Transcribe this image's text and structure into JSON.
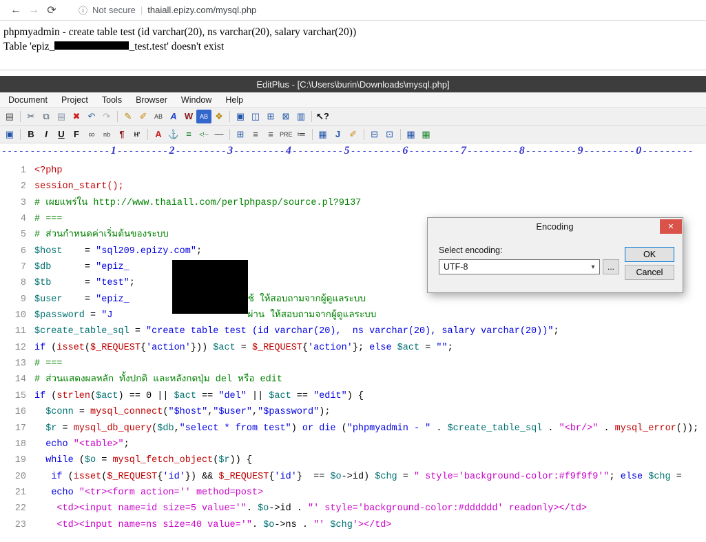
{
  "browser": {
    "back_icon": "←",
    "forward_icon": "→",
    "refresh_icon": "⟳",
    "info_icon": "ⓘ",
    "security_label": "Not secure",
    "url_separator": "|",
    "url": "thaiall.epizy.com/mysql.php",
    "page_line1": "phpmyadmin - create table test (id varchar(20), ns varchar(20), salary varchar(20))",
    "page_line2_before": "Table 'epiz_",
    "page_line2_after": "_test.test' doesn't exist"
  },
  "editor": {
    "title": "EditPlus - [C:\\Users\\burin\\Downloads\\mysql.php]",
    "menus": [
      "Document",
      "Project",
      "Tools",
      "Browser",
      "Window",
      "Help"
    ],
    "ruler_numbers": [
      "1",
      "2",
      "3",
      "4",
      "5",
      "6",
      "7",
      "8",
      "9",
      "0"
    ],
    "toolbar_row1": [
      {
        "glyph": "▤",
        "name": "document-icon",
        "color": "#555555"
      },
      {
        "sep": true
      },
      {
        "glyph": "✂",
        "name": "cut-icon",
        "color": "#445566"
      },
      {
        "glyph": "⧉",
        "name": "copy-icon",
        "color": "#445566"
      },
      {
        "glyph": "▤",
        "name": "paste-icon",
        "color": "#8899aa"
      },
      {
        "glyph": "✖",
        "name": "delete-icon",
        "color": "#cc2222"
      },
      {
        "glyph": "↶",
        "name": "undo-icon",
        "color": "#336699"
      },
      {
        "glyph": "↷",
        "name": "redo-icon",
        "color": "#b0b0b0"
      },
      {
        "sep": true
      },
      {
        "glyph": "✎",
        "name": "edit-pencil-icon",
        "color": "#b8860b"
      },
      {
        "glyph": "✐",
        "name": "marker-icon",
        "color": "#cc8800"
      },
      {
        "glyph": "AB",
        "name": "select-text-icon",
        "color": "#333333",
        "small": true
      },
      {
        "glyph": "A",
        "name": "font-italic-icon",
        "color": "#2244cc",
        "italic": true,
        "bold": true
      },
      {
        "glyph": "W",
        "name": "spellcheck-icon",
        "color": "#8b1a1a",
        "bold": true
      },
      {
        "glyph": "AB",
        "name": "highlight-icon",
        "color": "#ffffff",
        "bg": "#3366cc",
        "small": true
      },
      {
        "glyph": "❖",
        "name": "stamp-icon",
        "color": "#b8860b"
      },
      {
        "sep": true
      },
      {
        "glyph": "▣",
        "name": "window-full-icon",
        "color": "#2255aa"
      },
      {
        "glyph": "◫",
        "name": "window-split-icon",
        "color": "#2255aa"
      },
      {
        "glyph": "⊞",
        "name": "window-table-icon",
        "color": "#2255aa"
      },
      {
        "glyph": "⊠",
        "name": "window-close-icon",
        "color": "#2255aa"
      },
      {
        "glyph": "▥",
        "name": "window-list-icon",
        "color": "#2255aa"
      },
      {
        "sep": true
      },
      {
        "glyph": "↖?",
        "name": "context-help-icon",
        "color": "#111111",
        "bold": true
      }
    ],
    "toolbar_row2": [
      {
        "glyph": "▣",
        "name": "view-browser-icon",
        "color": "#2255aa"
      },
      {
        "sep": true
      },
      {
        "glyph": "B",
        "name": "bold-icon",
        "color": "#111111",
        "bold": true
      },
      {
        "glyph": "I",
        "name": "italic-icon",
        "color": "#111111",
        "italic": true,
        "bold": true
      },
      {
        "glyph": "U",
        "name": "underline-icon",
        "color": "#111111",
        "underline": true,
        "bold": true
      },
      {
        "glyph": "F",
        "name": "font-icon",
        "color": "#111111",
        "bold": true
      },
      {
        "glyph": "∞",
        "name": "glasses-icon",
        "color": "#555555"
      },
      {
        "glyph": "nb",
        "name": "nbsp-icon",
        "color": "#333333",
        "small": true
      },
      {
        "glyph": "¶",
        "name": "paragraph-icon",
        "color": "#8b1a1a",
        "bold": true
      },
      {
        "glyph": "H'",
        "name": "heading-icon",
        "color": "#111111",
        "bold": true,
        "small": true
      },
      {
        "sep": true
      },
      {
        "glyph": "A",
        "name": "font-color-icon",
        "color": "#cc2222",
        "bold": true
      },
      {
        "glyph": "⚓",
        "name": "anchor-icon",
        "color": "#2255aa"
      },
      {
        "glyph": "=",
        "name": "equals-icon",
        "color": "#228833",
        "bold": true
      },
      {
        "glyph": "<!--",
        "name": "comment-icon",
        "color": "#228833",
        "small": true
      },
      {
        "glyph": "—",
        "name": "hr-icon",
        "color": "#333333"
      },
      {
        "sep": true
      },
      {
        "glyph": "⊞",
        "name": "table-icon",
        "color": "#2255aa"
      },
      {
        "glyph": "≡",
        "name": "align-left-icon",
        "color": "#333333"
      },
      {
        "glyph": "≡",
        "name": "align-center-icon",
        "color": "#333333"
      },
      {
        "glyph": "PRE",
        "name": "pre-icon",
        "color": "#333333",
        "small": true
      },
      {
        "glyph": "≔",
        "name": "list-icon",
        "color": "#333333"
      },
      {
        "sep": true
      },
      {
        "glyph": "▦",
        "name": "image-icon",
        "color": "#2255aa"
      },
      {
        "glyph": "J",
        "name": "javascript-icon",
        "color": "#2255aa",
        "bold": true
      },
      {
        "glyph": "✐",
        "name": "style-brush-icon",
        "color": "#cc8822"
      },
      {
        "sep": true
      },
      {
        "glyph": "⊟",
        "name": "sync-browser-icon",
        "color": "#2255aa"
      },
      {
        "glyph": "⊡",
        "name": "sync-file-icon",
        "color": "#2255aa"
      },
      {
        "sep": true
      },
      {
        "glyph": "▦",
        "name": "table-insert-icon",
        "color": "#2255aa"
      },
      {
        "glyph": "▦",
        "name": "table-green-icon",
        "color": "#228833"
      }
    ],
    "code_lines": [
      {
        "n": 1,
        "segs": [
          {
            "t": "<?php",
            "c": "php"
          }
        ]
      },
      {
        "n": 2,
        "segs": [
          {
            "t": "session_start();",
            "c": "fn"
          }
        ]
      },
      {
        "n": 3,
        "segs": [
          {
            "t": "# เผยแพร่ใน http://www.thaiall.com/perlphpasp/source.pl?9137",
            "c": "com"
          }
        ]
      },
      {
        "n": 4,
        "segs": [
          {
            "t": "# ===",
            "c": "com"
          }
        ]
      },
      {
        "n": 5,
        "segs": [
          {
            "t": "# ส่วนกำหนดค่าเริ่มต้นของระบบ",
            "c": "com"
          }
        ]
      },
      {
        "n": 6,
        "segs": [
          {
            "t": "$host",
            "c": "var"
          },
          {
            "t": "    = ",
            "c": "pl"
          },
          {
            "t": "\"sql209.epizy.com\"",
            "c": "str"
          },
          {
            "t": ";",
            "c": "pl"
          }
        ]
      },
      {
        "n": 7,
        "segs": [
          {
            "t": "$db",
            "c": "var"
          },
          {
            "t": "      = ",
            "c": "pl"
          },
          {
            "t": "\"epiz_",
            "c": "str"
          }
        ]
      },
      {
        "n": 8,
        "segs": [
          {
            "t": "$tb",
            "c": "var"
          },
          {
            "t": "      = ",
            "c": "pl"
          },
          {
            "t": "\"test\"",
            "c": "str"
          },
          {
            "t": ";",
            "c": "pl"
          }
        ]
      },
      {
        "n": 9,
        "segs": [
          {
            "t": "$user",
            "c": "var"
          },
          {
            "t": "    = ",
            "c": "pl"
          },
          {
            "t": "\"epiz_",
            "c": "str"
          },
          {
            "c": "gap",
            "w": 172
          },
          {
            "t": "ช้ ให้สอบถามจากผู้ดูแลระบบ",
            "c": "com"
          }
        ]
      },
      {
        "n": 10,
        "segs": [
          {
            "t": "$password",
            "c": "var"
          },
          {
            "t": " = ",
            "c": "pl"
          },
          {
            "t": "\"J",
            "c": "str"
          },
          {
            "c": "gap",
            "w": 196
          },
          {
            "t": "ผ่าน ให้สอบถามจากผู้ดูแลระบบ",
            "c": "com"
          }
        ]
      },
      {
        "n": 11,
        "segs": [
          {
            "t": "$create_table_sql",
            "c": "var"
          },
          {
            "t": " = ",
            "c": "pl"
          },
          {
            "t": "\"create table test (id varchar(20),  ns varchar(20), salary varchar(20))\"",
            "c": "str"
          },
          {
            "t": ";",
            "c": "pl"
          }
        ]
      },
      {
        "n": 12,
        "segs": [
          {
            "t": "if",
            "c": "kw"
          },
          {
            "t": " (",
            "c": "pl"
          },
          {
            "t": "isset",
            "c": "fn"
          },
          {
            "t": "(",
            "c": "pl"
          },
          {
            "t": "$_REQUEST",
            "c": "fn"
          },
          {
            "t": "{",
            "c": "pl"
          },
          {
            "t": "'action'",
            "c": "str"
          },
          {
            "t": "})) ",
            "c": "pl"
          },
          {
            "t": "$act",
            "c": "var"
          },
          {
            "t": " = ",
            "c": "pl"
          },
          {
            "t": "$_REQUEST",
            "c": "fn"
          },
          {
            "t": "{",
            "c": "pl"
          },
          {
            "t": "'action'",
            "c": "str"
          },
          {
            "t": "}; ",
            "c": "pl"
          },
          {
            "t": "else",
            "c": "kw"
          },
          {
            "t": " ",
            "c": "pl"
          },
          {
            "t": "$act",
            "c": "var"
          },
          {
            "t": " = ",
            "c": "pl"
          },
          {
            "t": "\"\"",
            "c": "str"
          },
          {
            "t": ";",
            "c": "pl"
          }
        ]
      },
      {
        "n": 13,
        "segs": [
          {
            "t": "# ===",
            "c": "com"
          }
        ]
      },
      {
        "n": 14,
        "segs": [
          {
            "t": "# ส่วนแสดงผลหลัก ทั้งปกติ และหลังกดปุ่ม del หรือ edit",
            "c": "com"
          }
        ]
      },
      {
        "n": 15,
        "segs": [
          {
            "t": "if",
            "c": "kw"
          },
          {
            "t": " (",
            "c": "pl"
          },
          {
            "t": "strlen",
            "c": "fn"
          },
          {
            "t": "(",
            "c": "pl"
          },
          {
            "t": "$act",
            "c": "var"
          },
          {
            "t": ") == 0 || ",
            "c": "pl"
          },
          {
            "t": "$act",
            "c": "var"
          },
          {
            "t": " == ",
            "c": "pl"
          },
          {
            "t": "\"del\"",
            "c": "str"
          },
          {
            "t": " || ",
            "c": "pl"
          },
          {
            "t": "$act",
            "c": "var"
          },
          {
            "t": " == ",
            "c": "pl"
          },
          {
            "t": "\"edit\"",
            "c": "str"
          },
          {
            "t": ") {",
            "c": "pl"
          }
        ]
      },
      {
        "n": 16,
        "segs": [
          {
            "t": "  ",
            "c": "pl"
          },
          {
            "t": "$conn",
            "c": "var"
          },
          {
            "t": " = ",
            "c": "pl"
          },
          {
            "t": "mysql_connect",
            "c": "fn"
          },
          {
            "t": "(",
            "c": "pl"
          },
          {
            "t": "\"$host\"",
            "c": "str"
          },
          {
            "t": ",",
            "c": "pl"
          },
          {
            "t": "\"$user\"",
            "c": "str"
          },
          {
            "t": ",",
            "c": "pl"
          },
          {
            "t": "\"$password\"",
            "c": "str"
          },
          {
            "t": ");",
            "c": "pl"
          }
        ]
      },
      {
        "n": 17,
        "segs": [
          {
            "t": "  ",
            "c": "pl"
          },
          {
            "t": "$r",
            "c": "var"
          },
          {
            "t": " = ",
            "c": "pl"
          },
          {
            "t": "mysql_db_query",
            "c": "fn"
          },
          {
            "t": "(",
            "c": "pl"
          },
          {
            "t": "$db",
            "c": "var"
          },
          {
            "t": ",",
            "c": "pl"
          },
          {
            "t": "\"select * from test\"",
            "c": "str"
          },
          {
            "t": ") ",
            "c": "pl"
          },
          {
            "t": "or",
            "c": "kw"
          },
          {
            "t": " ",
            "c": "pl"
          },
          {
            "t": "die",
            "c": "kw"
          },
          {
            "t": " (",
            "c": "pl"
          },
          {
            "t": "\"phpmyadmin - \"",
            "c": "str"
          },
          {
            "t": " . ",
            "c": "pl"
          },
          {
            "t": "$create_table_sql",
            "c": "var"
          },
          {
            "t": " . ",
            "c": "pl"
          },
          {
            "t": "\"<br/>\"",
            "c": "html"
          },
          {
            "t": " . ",
            "c": "pl"
          },
          {
            "t": "mysql_error",
            "c": "fn"
          },
          {
            "t": "());",
            "c": "pl"
          }
        ]
      },
      {
        "n": 18,
        "segs": [
          {
            "t": "  ",
            "c": "pl"
          },
          {
            "t": "echo",
            "c": "kw"
          },
          {
            "t": " ",
            "c": "pl"
          },
          {
            "t": "\"<table>\"",
            "c": "html"
          },
          {
            "t": ";",
            "c": "pl"
          }
        ]
      },
      {
        "n": 19,
        "segs": [
          {
            "t": "  ",
            "c": "pl"
          },
          {
            "t": "while",
            "c": "kw"
          },
          {
            "t": " (",
            "c": "pl"
          },
          {
            "t": "$o",
            "c": "var"
          },
          {
            "t": " = ",
            "c": "pl"
          },
          {
            "t": "mysql_fetch_object",
            "c": "fn"
          },
          {
            "t": "(",
            "c": "pl"
          },
          {
            "t": "$r",
            "c": "var"
          },
          {
            "t": ")) {",
            "c": "pl"
          }
        ]
      },
      {
        "n": 20,
        "segs": [
          {
            "t": "   ",
            "c": "pl"
          },
          {
            "t": "if",
            "c": "kw"
          },
          {
            "t": " (",
            "c": "pl"
          },
          {
            "t": "isset",
            "c": "fn"
          },
          {
            "t": "(",
            "c": "pl"
          },
          {
            "t": "$_REQUEST",
            "c": "fn"
          },
          {
            "t": "{",
            "c": "pl"
          },
          {
            "t": "'id'",
            "c": "str"
          },
          {
            "t": "}) && ",
            "c": "pl"
          },
          {
            "t": "$_REQUEST",
            "c": "fn"
          },
          {
            "t": "{",
            "c": "pl"
          },
          {
            "t": "'id'",
            "c": "str"
          },
          {
            "t": "}  == ",
            "c": "pl"
          },
          {
            "t": "$o",
            "c": "var"
          },
          {
            "t": "->id) ",
            "c": "pl"
          },
          {
            "t": "$chg",
            "c": "var"
          },
          {
            "t": " = ",
            "c": "pl"
          },
          {
            "t": "\" style='background-color:#f9f9f9'\"",
            "c": "html"
          },
          {
            "t": "; ",
            "c": "pl"
          },
          {
            "t": "else",
            "c": "kw"
          },
          {
            "t": " ",
            "c": "pl"
          },
          {
            "t": "$chg",
            "c": "var"
          },
          {
            "t": " = ",
            "c": "pl"
          }
        ]
      },
      {
        "n": 21,
        "segs": [
          {
            "t": "   ",
            "c": "pl"
          },
          {
            "t": "echo",
            "c": "kw"
          },
          {
            "t": " ",
            "c": "pl"
          },
          {
            "t": "\"<tr><form action='' method=post>",
            "c": "html"
          }
        ]
      },
      {
        "n": 22,
        "segs": [
          {
            "t": "    ",
            "c": "pl"
          },
          {
            "t": "<td><input name=id size=5 value='\"",
            "c": "html"
          },
          {
            "t": ". ",
            "c": "pl"
          },
          {
            "t": "$o",
            "c": "var"
          },
          {
            "t": "->id . ",
            "c": "pl"
          },
          {
            "t": "\"' style='background-color:#dddddd' readonly></td>",
            "c": "html"
          }
        ]
      },
      {
        "n": 23,
        "segs": [
          {
            "t": "    ",
            "c": "pl"
          },
          {
            "t": "<td><input name=ns size=40 value='\"",
            "c": "html"
          },
          {
            "t": ". ",
            "c": "pl"
          },
          {
            "t": "$o",
            "c": "var"
          },
          {
            "t": "->ns . ",
            "c": "pl"
          },
          {
            "t": "\"' ",
            "c": "html"
          },
          {
            "t": "$chg",
            "c": "var"
          },
          {
            "t": "'></td>",
            "c": "html"
          }
        ]
      }
    ]
  },
  "dialog": {
    "title": "Encoding",
    "close_icon": "✕",
    "label": "Select encoding:",
    "selected": "UTF-8",
    "dropdown_arrow": "▾",
    "browse": "...",
    "ok": "OK",
    "cancel": "Cancel"
  },
  "colors": {
    "title_bar": "#3d3d3d",
    "dialog_close": "#d9534b",
    "syntax_comment": "#008000",
    "syntax_string": "#0000e0",
    "syntax_variable": "#007070",
    "syntax_html": "#c800c8",
    "syntax_function": "#c00000",
    "ruler": "#3333cc"
  }
}
